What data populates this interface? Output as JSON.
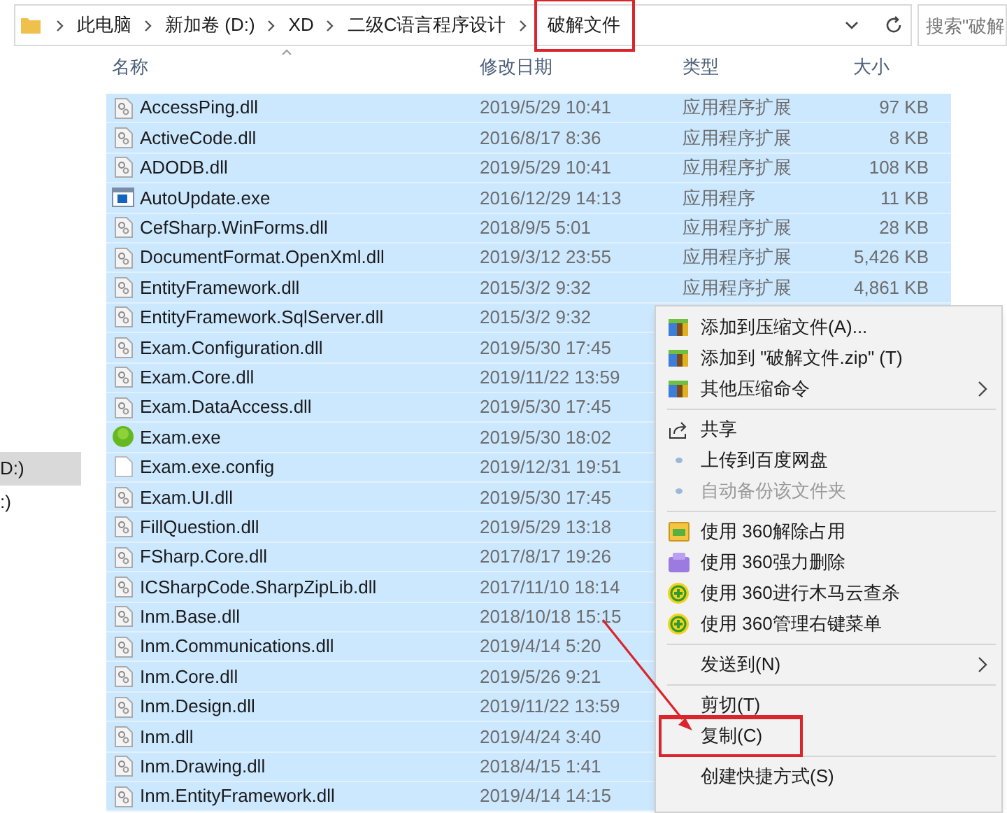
{
  "address_bar": {
    "path": [
      "此电脑",
      "新加卷 (D:)",
      "XD",
      "二级C语言程序设计",
      "破解文件"
    ],
    "search": {
      "placeholder": "搜索\"破解"
    }
  },
  "nav_pane": {
    "items": [
      {
        "label": "D:)",
        "selected": true
      },
      {
        "label": ":)",
        "selected": false
      }
    ]
  },
  "columns": [
    "名称",
    "修改日期",
    "类型",
    "大小"
  ],
  "files": [
    {
      "name": "AccessPing.dll",
      "kind": "dll",
      "date": "2019/5/29 10:41",
      "type": "应用程序扩展",
      "size": "97 KB",
      "selected": true
    },
    {
      "name": "ActiveCode.dll",
      "kind": "dll",
      "date": "2016/8/17 8:36",
      "type": "应用程序扩展",
      "size": "8 KB",
      "selected": true
    },
    {
      "name": "ADODB.dll",
      "kind": "dll",
      "date": "2019/5/29 10:41",
      "type": "应用程序扩展",
      "size": "108 KB",
      "selected": true
    },
    {
      "name": "AutoUpdate.exe",
      "kind": "exe",
      "date": "2016/12/29 14:13",
      "type": "应用程序",
      "size": "11 KB",
      "selected": true
    },
    {
      "name": "CefSharp.WinForms.dll",
      "kind": "dll",
      "date": "2018/9/5 5:01",
      "type": "应用程序扩展",
      "size": "28 KB",
      "selected": true
    },
    {
      "name": "DocumentFormat.OpenXml.dll",
      "kind": "dll",
      "date": "2019/3/12 23:55",
      "type": "应用程序扩展",
      "size": "5,426 KB",
      "selected": true
    },
    {
      "name": "EntityFramework.dll",
      "kind": "dll",
      "date": "2015/3/2 9:32",
      "type": "应用程序扩展",
      "size": "4,861 KB",
      "selected": true
    },
    {
      "name": "EntityFramework.SqlServer.dll",
      "kind": "dll",
      "date": "2015/3/2 9:32",
      "selected": true
    },
    {
      "name": "Exam.Configuration.dll",
      "kind": "dll",
      "date": "2019/5/30 17:45",
      "selected": true
    },
    {
      "name": "Exam.Core.dll",
      "kind": "dll",
      "date": "2019/11/22 13:59",
      "selected": true
    },
    {
      "name": "Exam.DataAccess.dll",
      "kind": "dll",
      "date": "2019/5/30 17:45",
      "selected": true
    },
    {
      "name": "Exam.exe",
      "kind": "app",
      "date": "2019/5/30 18:02",
      "selected": true
    },
    {
      "name": "Exam.exe.config",
      "kind": "config",
      "date": "2019/12/31 19:51",
      "selected": true
    },
    {
      "name": "Exam.UI.dll",
      "kind": "dll",
      "date": "2019/5/30 17:45",
      "selected": true
    },
    {
      "name": "FillQuestion.dll",
      "kind": "dll",
      "date": "2019/5/29 13:18",
      "selected": true
    },
    {
      "name": "FSharp.Core.dll",
      "kind": "dll",
      "date": "2017/8/17 19:26",
      "selected": true
    },
    {
      "name": "ICSharpCode.SharpZipLib.dll",
      "kind": "dll",
      "date": "2017/11/10 18:14",
      "selected": true
    },
    {
      "name": "Inm.Base.dll",
      "kind": "dll",
      "date": "2018/10/18 15:15",
      "selected": true
    },
    {
      "name": "Inm.Communications.dll",
      "kind": "dll",
      "date": "2019/4/14 5:20",
      "selected": true
    },
    {
      "name": "Inm.Core.dll",
      "kind": "dll",
      "date": "2019/5/26 9:21",
      "selected": true
    },
    {
      "name": "Inm.Design.dll",
      "kind": "dll",
      "date": "2019/11/22 13:59",
      "selected": true
    },
    {
      "name": "Inm.dll",
      "kind": "dll",
      "date": "2019/4/24 3:40",
      "selected": true
    },
    {
      "name": "Inm.Drawing.dll",
      "kind": "dll",
      "date": "2018/4/15 1:41",
      "selected": true
    },
    {
      "name": "Inm.EntityFramework.dll",
      "kind": "dll",
      "date": "2019/4/14 14:15",
      "selected": true
    }
  ],
  "context_menu": [
    {
      "kind": "archive",
      "label": "添加到压缩文件(A)...",
      "disabled": false,
      "submenu": false,
      "highlighted": false
    },
    {
      "kind": "archive",
      "label": "添加到 \"破解文件.zip\" (T)",
      "disabled": false,
      "submenu": false,
      "highlighted": false
    },
    {
      "kind": "archive",
      "label": "其他压缩命令",
      "disabled": false,
      "submenu": true,
      "highlighted": false
    },
    {
      "kind": "separator"
    },
    {
      "kind": "share",
      "label": "共享",
      "disabled": false,
      "submenu": false,
      "highlighted": false
    },
    {
      "kind": "cloud",
      "label": "上传到百度网盘",
      "disabled": false,
      "submenu": false,
      "highlighted": false
    },
    {
      "kind": "cloud",
      "label": "自动备份该文件夹",
      "disabled": true,
      "submenu": false,
      "highlighted": false
    },
    {
      "kind": "separator"
    },
    {
      "kind": "folder",
      "label": "使用 360解除占用",
      "disabled": false,
      "submenu": false,
      "highlighted": false
    },
    {
      "kind": "eraser",
      "label": "使用 360强力删除",
      "disabled": false,
      "submenu": false,
      "highlighted": false
    },
    {
      "kind": "shield",
      "label": "使用 360进行木马云查杀",
      "disabled": false,
      "submenu": false,
      "highlighted": false
    },
    {
      "kind": "shield",
      "label": "使用 360管理右键菜单",
      "disabled": false,
      "submenu": false,
      "highlighted": false
    },
    {
      "kind": "separator"
    },
    {
      "kind": "plain",
      "label": "发送到(N)",
      "disabled": false,
      "submenu": true,
      "highlighted": false
    },
    {
      "kind": "separator"
    },
    {
      "kind": "plain",
      "label": "剪切(T)",
      "disabled": false,
      "submenu": false,
      "highlighted": false
    },
    {
      "kind": "plain",
      "label": "复制(C)",
      "disabled": false,
      "submenu": false,
      "highlighted": true
    },
    {
      "kind": "separator"
    },
    {
      "kind": "plain",
      "label": "创建快捷方式(S)",
      "disabled": false,
      "submenu": false,
      "highlighted": false
    }
  ]
}
